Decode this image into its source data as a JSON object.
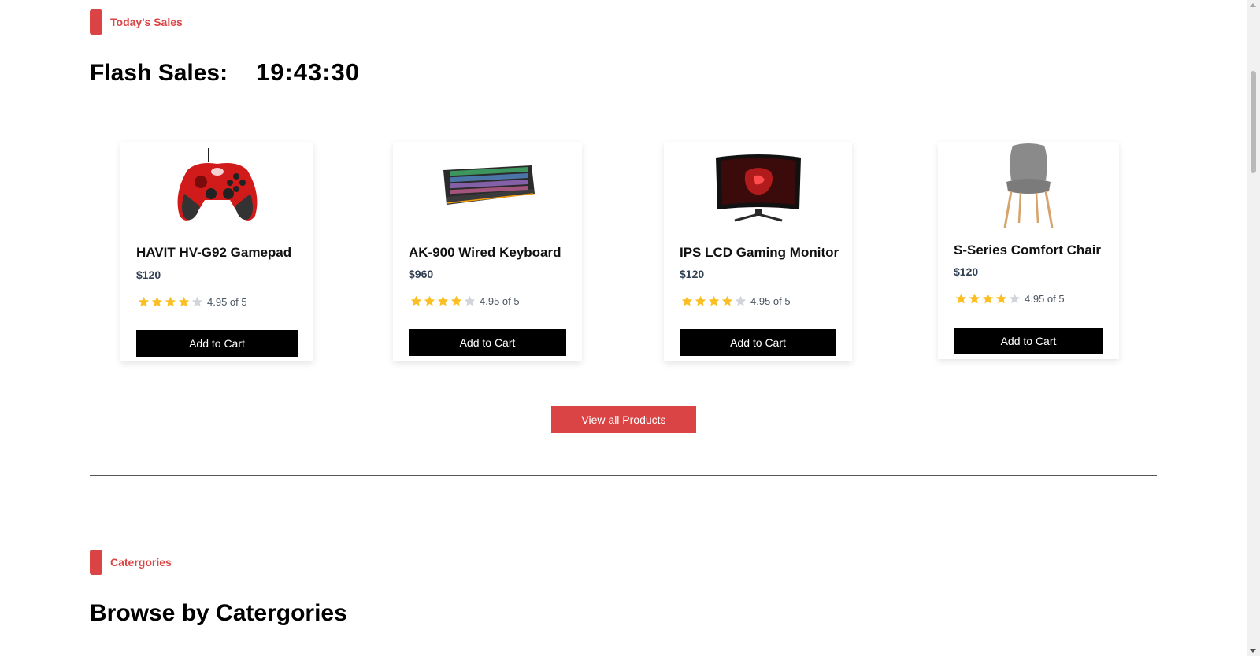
{
  "flash_section": {
    "tag": "Today's Sales",
    "title": "Flash Sales:",
    "timer": "19:43:30"
  },
  "products": [
    {
      "name": "HAVIT HV-G92 Gamepad",
      "price": "$120",
      "rating_text": "4.95 of 5",
      "stars": 4,
      "button": "Add to Cart",
      "image_icon": "gamepad-icon"
    },
    {
      "name": "AK-900 Wired Keyboard",
      "price": "$960",
      "rating_text": "4.95 of 5",
      "stars": 4,
      "button": "Add to Cart",
      "image_icon": "keyboard-icon"
    },
    {
      "name": "IPS LCD Gaming Monitor",
      "price": "$120",
      "rating_text": "4.95 of 5",
      "stars": 4,
      "button": "Add to Cart",
      "image_icon": "monitor-icon"
    },
    {
      "name": "S-Series Comfort Chair",
      "price": "$120",
      "rating_text": "4.95 of 5",
      "stars": 4,
      "button": "Add to Cart",
      "image_icon": "chair-icon"
    }
  ],
  "view_all_label": "View all Products",
  "categories_section": {
    "tag": "Catergories",
    "title": "Browse by Catergories"
  },
  "colors": {
    "accent": "#db4444",
    "star_filled": "#fbbf24",
    "star_empty": "#d1d5db",
    "button_dark": "#000000"
  }
}
